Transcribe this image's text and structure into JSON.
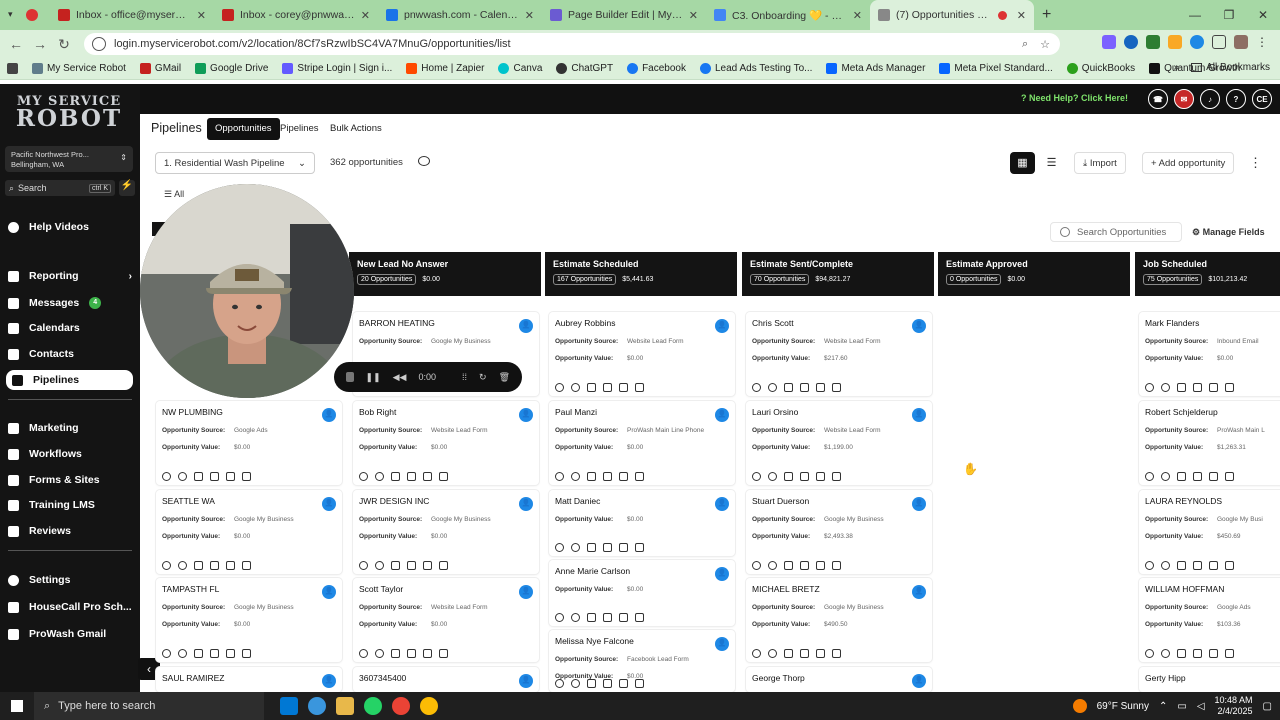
{
  "browser": {
    "tabs": [
      {
        "label": "",
        "fav": "#d33"
      },
      {
        "label": "Inbox - office@myservicerobot.",
        "fav": "#c5221f"
      },
      {
        "label": "Inbox - corey@pnwwash.com",
        "fav": "#c5221f"
      },
      {
        "label": "pnwwash.com - Calendar - Feb",
        "fav": "#1a73e8"
      },
      {
        "label": "Page Builder Edit | My Service R",
        "fav": "#6b5bd2"
      },
      {
        "label": "C3. Onboarding 💛 - Google D",
        "fav": "#4285f4"
      },
      {
        "label": "(7) Opportunities List | Paci",
        "fav": "#888"
      }
    ],
    "url": "login.myservicerobot.com/v2/location/8Cf7sRzwIbSC4VA7MnuG/opportunities/list",
    "bookmarks": [
      "My Service Robot",
      "GMail",
      "Google Drive",
      "Stripe Login | Sign i...",
      "Home | Zapier",
      "Canva",
      "ChatGPT",
      "Facebook",
      "Lead Ads Testing To...",
      "Meta Ads Manager",
      "Meta Pixel Standard...",
      "QuickBooks",
      "Quantum Growth"
    ],
    "all_bookmarks": "All Bookmarks"
  },
  "app": {
    "help": "Need Help? Click Here!",
    "avatar": "CE",
    "logo_top": "MY SERVICE",
    "logo_bottom": "ROBOT",
    "location_name": "Pacific Northwest Pro...",
    "location_city": "Bellingham, WA",
    "search_label": "Search",
    "search_kbd": "ctrl K",
    "nav": [
      {
        "label": "Help Videos"
      },
      {
        "label": "Reporting"
      },
      {
        "label": "Messages",
        "badge": "4"
      },
      {
        "label": "Calendars"
      },
      {
        "label": "Contacts"
      },
      {
        "label": "Pipelines"
      },
      {
        "label": "Marketing"
      },
      {
        "label": "Workflows"
      },
      {
        "label": "Forms & Sites"
      },
      {
        "label": "Training LMS"
      },
      {
        "label": "Reviews"
      },
      {
        "label": "Settings"
      },
      {
        "label": "HouseCall Pro Sch..."
      },
      {
        "label": "ProWash Gmail"
      }
    ]
  },
  "header": {
    "title": "Pipelines",
    "tabs": [
      "Opportunities",
      "Pipelines",
      "Bulk Actions"
    ],
    "pipeline": "1. Residential Wash Pipeline",
    "count": "362 opportunities",
    "import": "Import",
    "add": "Add opportunity",
    "filter_all": "All",
    "search_placeholder": "Search Opportunities",
    "manage_fields": "Manage Fields"
  },
  "player": {
    "time": "0:00"
  },
  "labels": {
    "source": "Opportunity Source:",
    "value": "Opportunity Value:"
  },
  "columns": [
    {
      "name": "New Lead No Answer",
      "count": "20 Opportunities",
      "total": "$0.00"
    },
    {
      "name": "Estimate Scheduled",
      "count": "167 Opportunities",
      "total": "$5,441.63"
    },
    {
      "name": "Estimate Sent/Complete",
      "count": "70 Opportunities",
      "total": "$94,821.27"
    },
    {
      "name": "Estimate Approved",
      "count": "0 Opportunities",
      "total": "$0.00"
    },
    {
      "name": "Job Scheduled",
      "count": "75 Opportunities",
      "total": "$101,213.42"
    }
  ],
  "cards": {
    "c0": [
      {
        "name": "NW PLUMBING",
        "source": "Google Ads",
        "value": "$0.00"
      },
      {
        "name": "SEATTLE WA",
        "source": "Google My Business",
        "value": "$0.00"
      },
      {
        "name": "TAMPASTH FL",
        "source": "Google My Business",
        "value": "$0.00"
      },
      {
        "name": "SAUL RAMIREZ",
        "source": "",
        "value": ""
      }
    ],
    "c1": [
      {
        "name": "BARRON HEATING",
        "source": "Google My Business",
        "value": ""
      },
      {
        "name": "Bob Right",
        "source": "Website Lead Form",
        "value": "$0.00"
      },
      {
        "name": "JWR DESIGN INC",
        "source": "Google My Business",
        "value": "$0.00"
      },
      {
        "name": "Scott Taylor",
        "source": "Website Lead Form",
        "value": "$0.00"
      },
      {
        "name": "3607345400",
        "source": "",
        "value": ""
      }
    ],
    "c2": [
      {
        "name": "Aubrey Robbins",
        "source": "Website Lead Form",
        "value": "$0.00"
      },
      {
        "name": "Paul Manzi",
        "source": "ProWash Main Line Phone",
        "value": "$0.00"
      },
      {
        "name": "Matt Daniec",
        "source": "",
        "value": "$0.00"
      },
      {
        "name": "Anne Marie Carlson",
        "source": "",
        "value": "$0.00"
      },
      {
        "name": "Melissa Nye Falcone",
        "source": "Facebook Lead Form",
        "value": "$0.00"
      }
    ],
    "c3": [
      {
        "name": "Chris Scott",
        "source": "Website Lead Form",
        "value": "$217.60"
      },
      {
        "name": "Lauri Orsino",
        "source": "Website Lead Form",
        "value": "$1,199.00"
      },
      {
        "name": "Stuart Duerson",
        "source": "Google My Business",
        "value": "$2,493.38"
      },
      {
        "name": "MICHAEL BRETZ",
        "source": "Google My Business",
        "value": "$490.50"
      },
      {
        "name": "George Thorp",
        "source": "",
        "value": ""
      }
    ],
    "c5": [
      {
        "name": "Mark Flanders",
        "source": "Inbound Email",
        "value": "$0.00"
      },
      {
        "name": "Robert Schjelderup",
        "source": "ProWash Main L",
        "value": "$1,263.31"
      },
      {
        "name": "LAURA REYNOLDS",
        "source": "Google My Busi",
        "value": "$450.69"
      },
      {
        "name": "WILLIAM HOFFMAN",
        "source": "Google Ads",
        "value": "$103.36"
      },
      {
        "name": "Gerty Hipp",
        "source": "",
        "value": ""
      }
    ]
  },
  "taskbar": {
    "search": "Type here to search",
    "weather": "69°F  Sunny",
    "time": "10:48 AM",
    "date": "2/4/2025"
  }
}
